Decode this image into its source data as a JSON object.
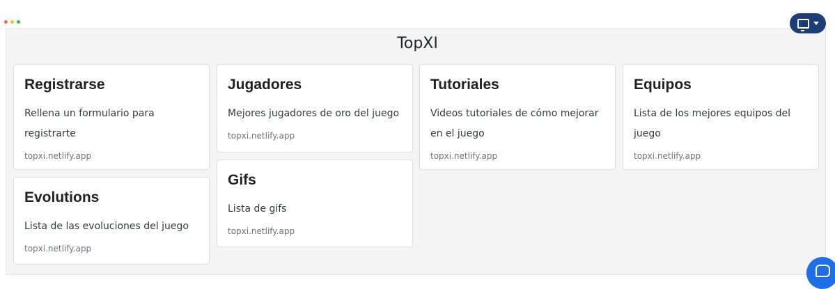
{
  "page": {
    "title": "TopXI"
  },
  "toolbar": {
    "display_icon": "monitor-icon",
    "dropdown_icon": "caret-down-icon"
  },
  "cards": [
    {
      "title": "Registrarse",
      "text": "Rellena un formulario para registrarte",
      "link": "topxi.netlify.app"
    },
    {
      "title": "Jugadores",
      "text": "Mejores jugadores de oro del juego",
      "link": "topxi.netlify.app"
    },
    {
      "title": "Tutoriales",
      "text": "Videos tutoriales de cómo mejorar en el juego",
      "link": "topxi.netlify.app"
    },
    {
      "title": "Equipos",
      "text": "Lista de los mejores equipos del juego",
      "link": "topxi.netlify.app"
    },
    {
      "title": "Evolutions",
      "text": "Lista de las evoluciones del juego",
      "link": "topxi.netlify.app"
    },
    {
      "title": "Gifs",
      "text": "Lista de gifs",
      "link": "topxi.netlify.app"
    }
  ],
  "chat": {
    "icon": "chat-icon"
  },
  "colors": {
    "accent": "#1c3d7a",
    "chat": "#1f6fe6",
    "dot_red": "#ff5f57",
    "dot_yellow": "#febc2e",
    "dot_green": "#28c840"
  }
}
